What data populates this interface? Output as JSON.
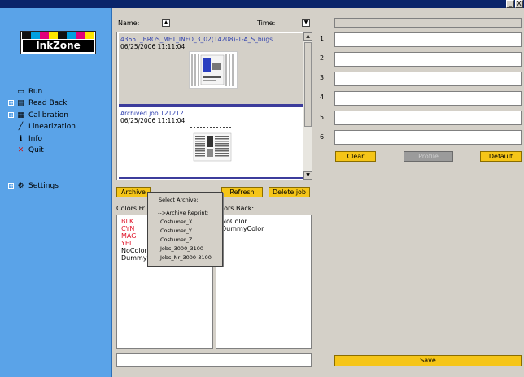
{
  "window": {
    "min_label": "_",
    "close_label": "X"
  },
  "sidebar": {
    "logo_text": "InkZone",
    "logo_colors": [
      "#111111",
      "#00a0e0",
      "#e2007a",
      "#ffe600",
      "#111111",
      "#00a0e0",
      "#e2007a",
      "#ffe600"
    ],
    "items": [
      {
        "label": "Run",
        "icon": "run-icon",
        "expand": ""
      },
      {
        "label": "Read Back",
        "icon": "read-back-icon",
        "expand": "+"
      },
      {
        "label": "Calibration",
        "icon": "calibration-icon",
        "expand": "+"
      },
      {
        "label": "Linearization",
        "icon": "linearization-icon",
        "expand": ""
      },
      {
        "label": "Info",
        "icon": "info-icon",
        "expand": ""
      },
      {
        "label": "Quit",
        "icon": "quit-icon",
        "expand": ""
      },
      {
        "label": "Settings",
        "icon": "settings-icon",
        "expand": "+"
      }
    ]
  },
  "sort": {
    "name_label": "Name:",
    "time_label": "Time:"
  },
  "jobs": [
    {
      "title": "43651_BROS_MET_INFO_3_02(14208)-1-A_S_bugs",
      "date": "06/25/2006 11:11:04"
    },
    {
      "title": "Archived job 121212",
      "date": "06/25/2006 11:11:04"
    }
  ],
  "actions": {
    "archive": "Archive",
    "refresh": "Refresh",
    "delete_job": "Delete job"
  },
  "archive_menu": {
    "header": "Select Archive:",
    "items": [
      "-->Archive Reprint:",
      "Costumer_X",
      "Costumer_Y",
      "Costumer_Z",
      "Jobs_3000_3100",
      "Jobs_Nr_3000-3100"
    ]
  },
  "colors_front": {
    "label": "Colors Fr",
    "items": [
      {
        "name": "BLK",
        "color": "#e0182d"
      },
      {
        "name": "CYN",
        "color": "#e0182d"
      },
      {
        "name": "MAG",
        "color": "#e0182d"
      },
      {
        "name": "YEL",
        "color": "#e0182d"
      },
      {
        "name": "NoColor",
        "color": "#000000"
      },
      {
        "name": "Dummy",
        "color": "#000000"
      }
    ]
  },
  "colors_back": {
    "label": "olors Back:",
    "items": [
      {
        "name": "NoColor",
        "color": "#000000"
      },
      {
        "name": "DummyColor",
        "color": "#000000"
      }
    ]
  },
  "bottom_field": {
    "value": ""
  },
  "right": {
    "rows": [
      "1",
      "2",
      "3",
      "4",
      "5",
      "6"
    ],
    "clear": "Clear",
    "profile": "Profile",
    "default": "Default",
    "save": "Save"
  }
}
